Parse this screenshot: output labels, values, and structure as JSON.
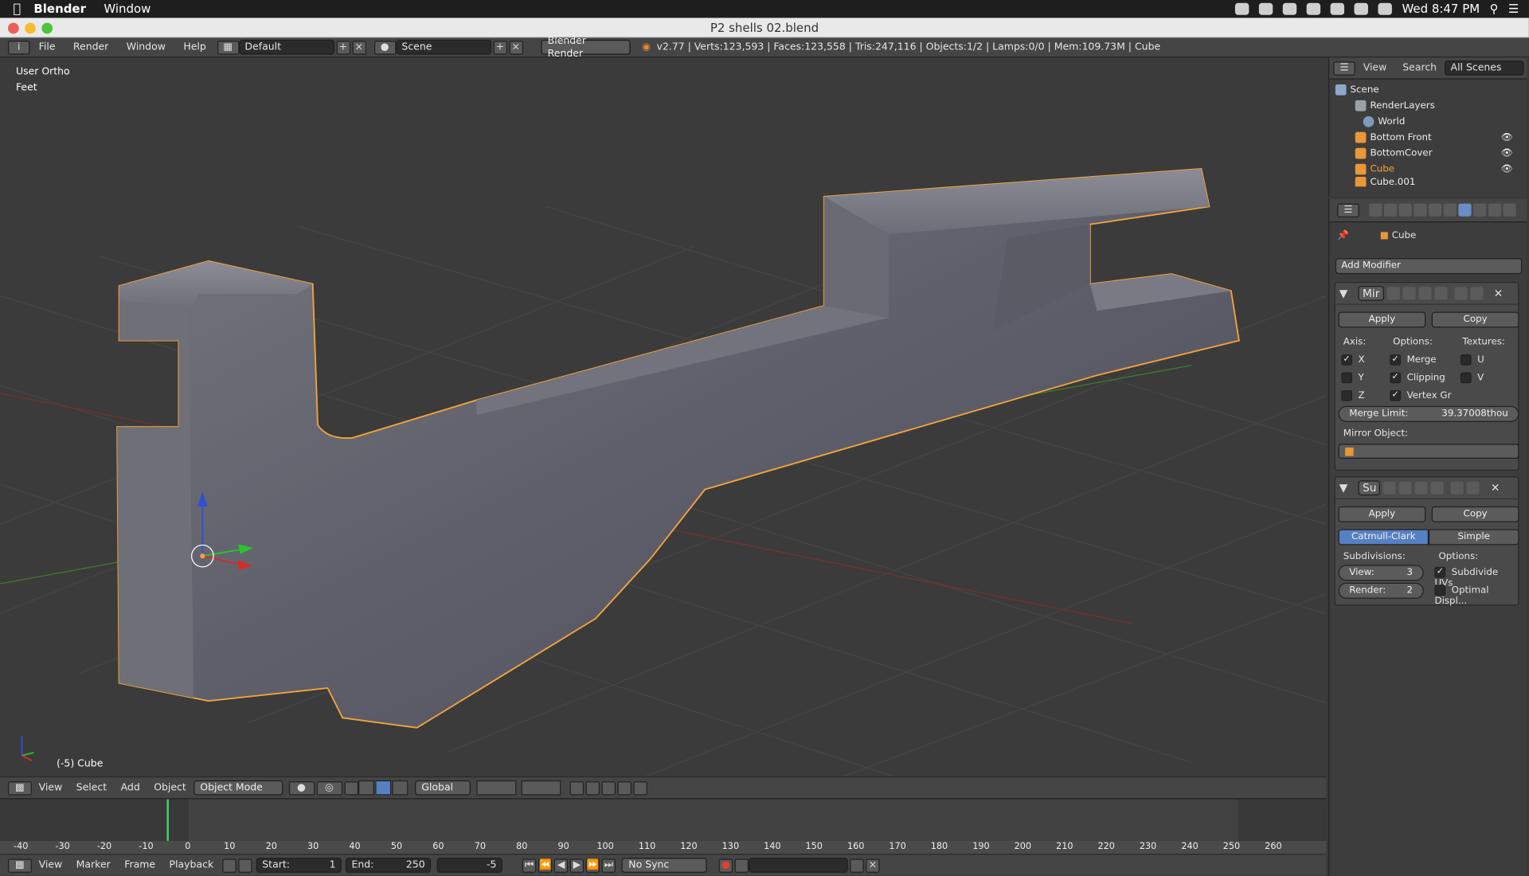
{
  "menubar": {
    "app": "Blender",
    "menu_window": "Window",
    "clock": "Wed 8:47 PM"
  },
  "titlebar": {
    "title": "P2 shells 02.blend"
  },
  "info": {
    "file": "File",
    "render": "Render",
    "window": "Window",
    "help": "Help",
    "layout": "Default",
    "scene": "Scene",
    "engine": "Blender Render",
    "stats": "v2.77 | Verts:123,593 | Faces:123,558 | Tris:247,116 | Objects:1/2 | Lamps:0/0 | Mem:109.73M | Cube"
  },
  "viewport": {
    "view_name": "User Ortho",
    "units": "Feet",
    "object_label": "(-5) Cube"
  },
  "header3d": {
    "view": "View",
    "select": "Select",
    "add": "Add",
    "object": "Object",
    "mode": "Object Mode",
    "orientation": "Global"
  },
  "timeline": {
    "view": "View",
    "marker": "Marker",
    "frame": "Frame",
    "playback": "Playback",
    "start_label": "Start:",
    "start_value": "1",
    "end_label": "End:",
    "end_value": "250",
    "current": "-5",
    "sync": "No Sync",
    "ruler": [
      "-40",
      "-30",
      "-20",
      "-10",
      "0",
      "10",
      "20",
      "30",
      "40",
      "50",
      "60",
      "70",
      "80",
      "90",
      "100",
      "110",
      "120",
      "130",
      "140",
      "150",
      "160",
      "170",
      "180",
      "190",
      "200",
      "210",
      "220",
      "230",
      "240",
      "250",
      "260"
    ],
    "current_frame": -5
  },
  "outliner": {
    "view": "View",
    "search": "Search",
    "scope": "All Scenes",
    "items": [
      {
        "label": "Scene"
      },
      {
        "label": "RenderLayers"
      },
      {
        "label": "World"
      },
      {
        "label": "Bottom Front"
      },
      {
        "label": "BottomCover"
      },
      {
        "label": "Cube"
      },
      {
        "label": "Cube.001"
      }
    ]
  },
  "properties": {
    "object": "Cube",
    "add_modifier": "Add Modifier",
    "mirror": {
      "name": "Mir",
      "apply": "Apply",
      "copy": "Copy",
      "axis": "Axis:",
      "options": "Options:",
      "textures": "Textures:",
      "x": "X",
      "y": "Y",
      "z": "Z",
      "merge": "Merge",
      "clipping": "Clipping",
      "vertex_gr": "Vertex Gr",
      "u": "U",
      "v": "V",
      "merge_limit_label": "Merge Limit:",
      "merge_limit_value": "39.37008thou",
      "mirror_object": "Mirror Object:"
    },
    "subsurf": {
      "name": "Su",
      "apply": "Apply",
      "copy": "Copy",
      "catmull": "Catmull-Clark",
      "simple": "Simple",
      "subdivisions": "Subdivisions:",
      "options": "Options:",
      "view_label": "View:",
      "view_value": "3",
      "render_label": "Render:",
      "render_value": "2",
      "subdivide_uvs": "Subdivide UVs",
      "optimal": "Optimal Displ..."
    }
  },
  "colors": {
    "accent": "#5680c2",
    "selection_outline": "#f2a33a"
  }
}
